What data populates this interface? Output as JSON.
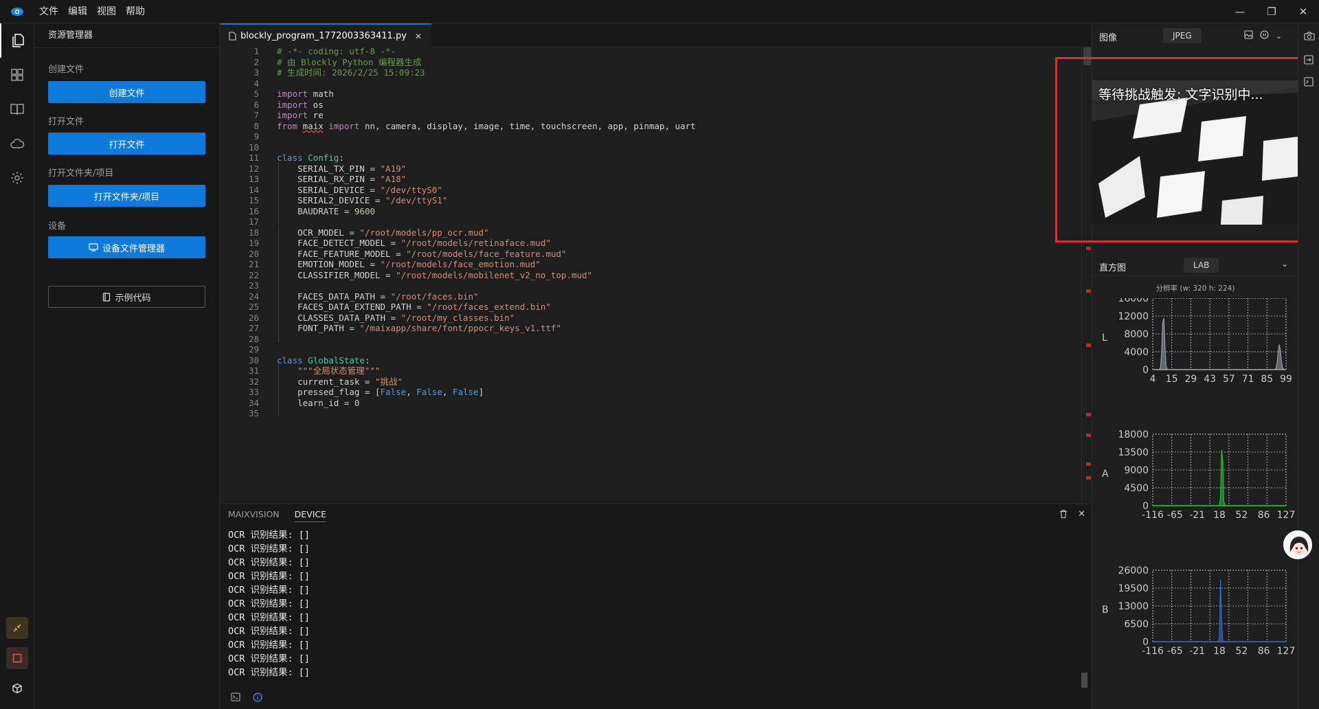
{
  "menu": [
    "文件",
    "编辑",
    "视图",
    "帮助"
  ],
  "sidebar": {
    "title": "资源管理器",
    "sections": [
      {
        "label": "创建文件",
        "button": "创建文件"
      },
      {
        "label": "打开文件",
        "button": "打开文件"
      },
      {
        "label": "打开文件夹/项目",
        "button": "打开文件夹/项目"
      },
      {
        "label": "设备",
        "button": "设备文件管理器"
      }
    ],
    "example_button": "示例代码"
  },
  "editor": {
    "tab_name": "blockly_program_1772003363411.py",
    "lines": [
      {
        "n": 1,
        "html": "<span class='c'># -*- coding: utf-8 -*-</span>"
      },
      {
        "n": 2,
        "html": "<span class='c'># 由 Blockly Python 编程器生成</span>"
      },
      {
        "n": 3,
        "html": "<span class='c'># 生成时间: 2026/2/25 15:09:23</span>"
      },
      {
        "n": 4,
        "html": ""
      },
      {
        "n": 5,
        "html": "<span class='k'>import</span> math"
      },
      {
        "n": 6,
        "html": "<span class='k'>import</span> os"
      },
      {
        "n": 7,
        "html": "<span class='k'>import</span> re"
      },
      {
        "n": 8,
        "html": "<span class='k'>from</span> <span class='w'>maix</span> <span class='k'>import</span> nn, camera, display, image, time, touchscreen, app, pinmap, uart"
      },
      {
        "n": 9,
        "html": ""
      },
      {
        "n": 10,
        "html": ""
      },
      {
        "n": 11,
        "html": "<span class='kb'>class</span> <span class='cl'>Config</span>:"
      },
      {
        "n": 12,
        "html": "    SERIAL_TX_PIN = <span class='s'>\"A19\"</span>"
      },
      {
        "n": 13,
        "html": "    SERIAL_RX_PIN = <span class='s'>\"A18\"</span>"
      },
      {
        "n": 14,
        "html": "    SERIAL_DEVICE = <span class='s'>\"/dev/ttyS0\"</span>"
      },
      {
        "n": 15,
        "html": "    SERIAL2_DEVICE = <span class='s'>\"/dev/ttyS1\"</span>"
      },
      {
        "n": 16,
        "html": "    BAUDRATE = <span class='n'>9600</span>"
      },
      {
        "n": 17,
        "html": ""
      },
      {
        "n": 18,
        "html": "    OCR_MODEL = <span class='s'>\"/root/models/pp_ocr.mud\"</span>"
      },
      {
        "n": 19,
        "html": "    FACE_DETECT_MODEL = <span class='s'>\"/root/models/retinaface.mud\"</span>"
      },
      {
        "n": 20,
        "html": "    FACE_FEATURE_MODEL = <span class='s'>\"/root/models/face_feature.mud\"</span>"
      },
      {
        "n": 21,
        "html": "    EMOTION_MODEL = <span class='s'>\"/root/models/face_emotion.mud\"</span>"
      },
      {
        "n": 22,
        "html": "    CLASSIFIER_MODEL = <span class='s'>\"/root/models/mobilenet_v2_no_top.mud\"</span>"
      },
      {
        "n": 23,
        "html": ""
      },
      {
        "n": 24,
        "html": "    FACES_DATA_PATH = <span class='s'>\"/root/faces.bin\"</span>"
      },
      {
        "n": 25,
        "html": "    FACES_DATA_EXTEND_PATH = <span class='s'>\"/root/faces_extend.bin\"</span>"
      },
      {
        "n": 26,
        "html": "    CLASSES_DATA_PATH = <span class='s'>\"/root/my_classes.bin\"</span>"
      },
      {
        "n": 27,
        "html": "    FONT_PATH = <span class='s'>\"/maixapp/share/font/ppocr_keys_v1.ttf\"</span>"
      },
      {
        "n": 28,
        "html": ""
      },
      {
        "n": 29,
        "html": ""
      },
      {
        "n": 30,
        "html": "<span class='kb'>class</span> <span class='cl'>GlobalState</span>:"
      },
      {
        "n": 31,
        "html": "    <span class='s'>\"\"\"全局状态管理\"\"\"</span>"
      },
      {
        "n": 32,
        "html": "    current_task = <span class='s'>\"挑战\"</span>"
      },
      {
        "n": 33,
        "html": "    pressed_flag = [<span class='kb'>False</span>, <span class='kb'>False</span>, <span class='kb'>False</span>]"
      },
      {
        "n": 34,
        "html": "    learn_id = <span class='n'>0</span>"
      },
      {
        "n": 35,
        "html": ""
      }
    ]
  },
  "terminal": {
    "tabs": [
      "MAIXVISION",
      "DEVICE"
    ],
    "active_tab": "DEVICE",
    "lines": [
      "OCR 识别结果: []",
      "OCR 识别结果: []",
      "OCR 识别结果: []",
      "OCR 识别结果: []",
      "OCR 识别结果: []",
      "OCR 识别结果: []",
      "OCR 识别结果: []",
      "OCR 识别结果: []",
      "OCR 识别结果: []",
      "OCR 识别结果: []",
      "OCR 识别结果: []"
    ]
  },
  "right_panel": {
    "image_title": "图像",
    "image_format": "JPEG",
    "preview_caption": "等待挑战触发: 文字识别中...",
    "histogram_title": "直方图",
    "histogram_mode": "LAB",
    "resolution": "分辨率 (w: 320 h: 224)",
    "histograms": [
      {
        "channel": "L",
        "color": "#9aa0a8",
        "yticks": [
          "16000",
          "12000",
          "8000",
          "4000",
          "0"
        ],
        "xticks": [
          "4",
          "15",
          "29",
          "43",
          "57",
          "71",
          "85",
          "99"
        ]
      },
      {
        "channel": "A",
        "color": "#1fc43a",
        "yticks": [
          "18000",
          "13500",
          "9000",
          "4500",
          "0"
        ],
        "xticks": [
          "-116",
          "-65",
          "-21",
          "18",
          "52",
          "86",
          "127"
        ]
      },
      {
        "channel": "B",
        "color": "#2a6ed8",
        "yticks": [
          "26000",
          "19500",
          "13000",
          "6500",
          "0"
        ],
        "xticks": [
          "-116",
          "-65",
          "-21",
          "18",
          "52",
          "86",
          "127"
        ]
      }
    ]
  },
  "colors": {
    "accent": "#0e7adb",
    "highlight": "#d93030"
  }
}
